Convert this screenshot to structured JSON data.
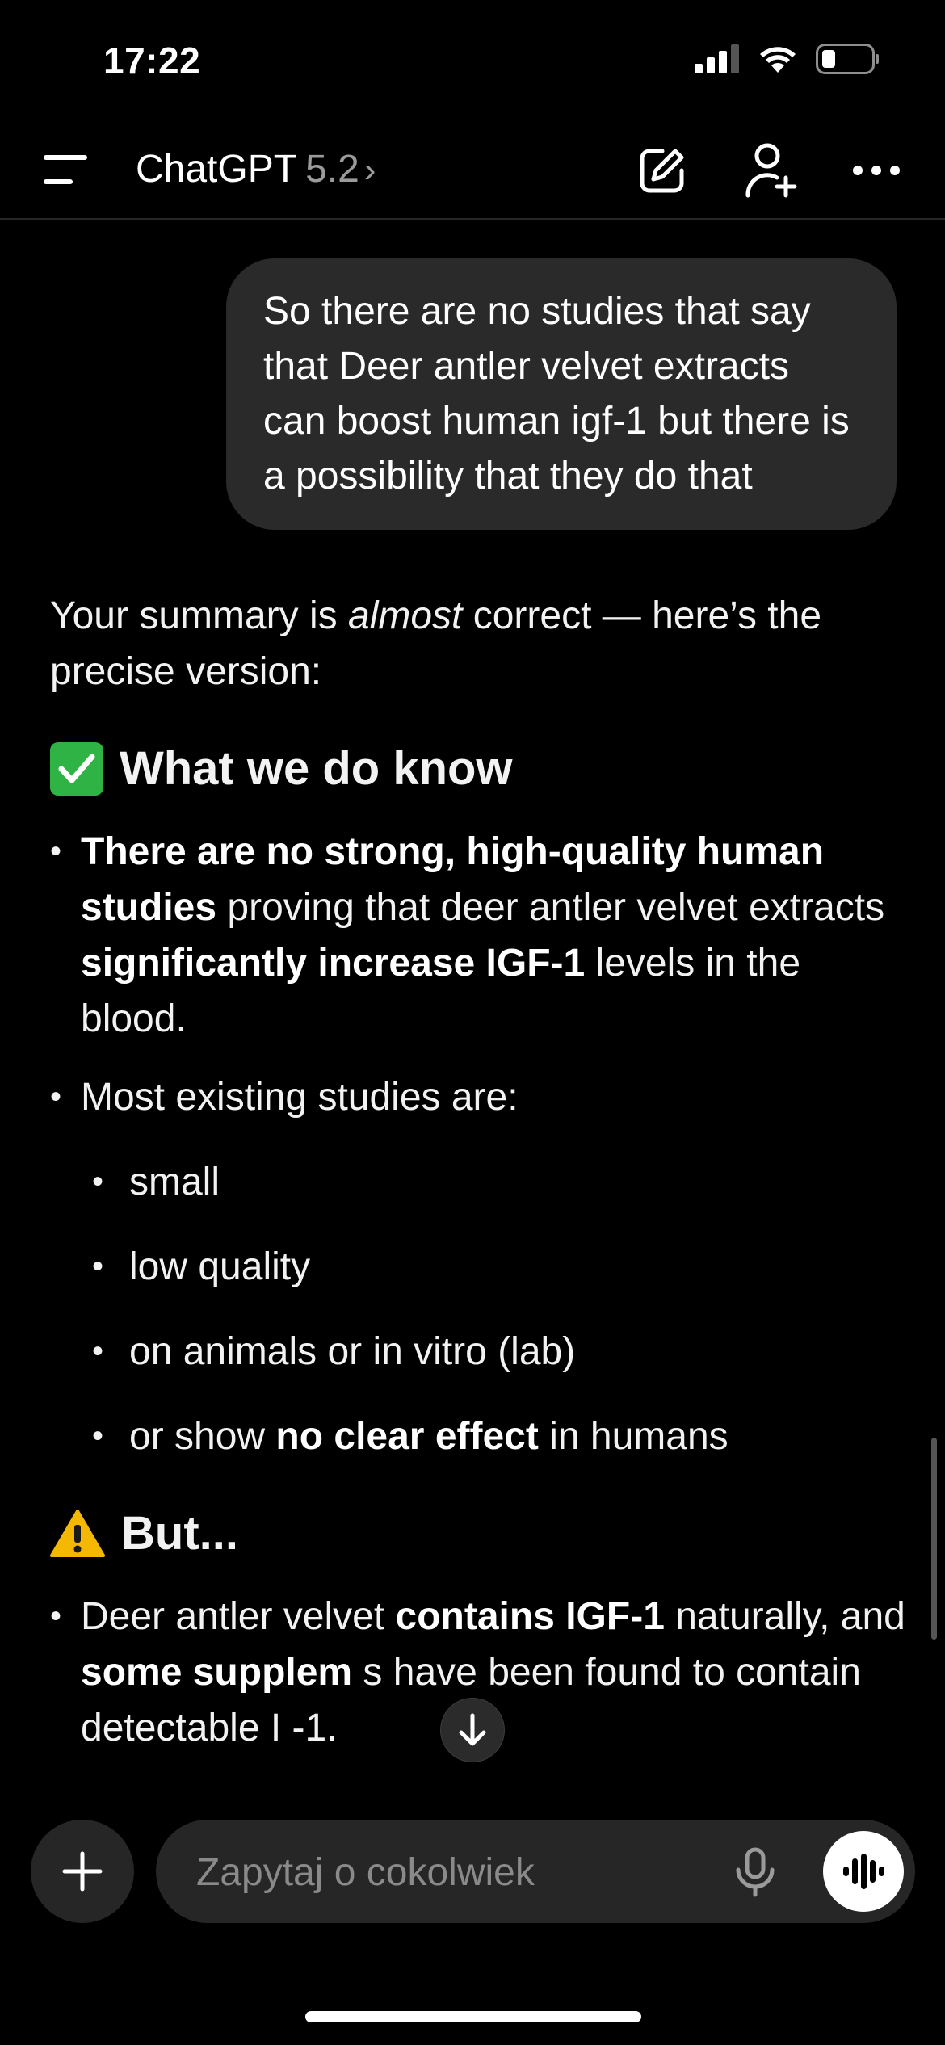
{
  "status": {
    "time": "17:22"
  },
  "header": {
    "title": "ChatGPT",
    "version": "5.2",
    "chevron": "›"
  },
  "user_message": "So there are no studies that say that Deer antler velvet extracts can boost human igf-1 but there is a possibility that they do that",
  "assistant": {
    "intro_pre": "Your summary is ",
    "intro_em": "almost",
    "intro_post": " correct — here’s the precise version:",
    "section1_title": "What we do know",
    "bullet1": {
      "b1": "There are no strong, high-quality human studies",
      "t1": " proving that deer antler velvet extracts ",
      "b2": "significantly increase IGF-1",
      "t2": " levels in the blood."
    },
    "bullet2": "Most existing studies are:",
    "sub_bullets": [
      "small",
      "low quality",
      "on animals or in vitro (lab)"
    ],
    "sub_bullet4": {
      "t1": "or show ",
      "b1": "no clear effect",
      "t2": " in humans"
    },
    "section2_title": "But...",
    "bullet3": {
      "t1": "Deer antler velvet ",
      "b1": "contains IGF-1",
      "t2": " naturally, and ",
      "b2": "some supplem",
      "t3": "   s have been found to contain detectable I",
      "t4": "   -1."
    }
  },
  "composer": {
    "placeholder": "Zapytaj o cokolwiek"
  },
  "icons": {
    "menu": "menu-icon",
    "new_chat": "edit-icon",
    "add_person": "add-person-icon",
    "more": "more-icon",
    "scroll_down": "arrow-down-icon",
    "plus": "plus-icon",
    "mic": "mic-icon",
    "voice": "voice-wave-icon"
  },
  "colors": {
    "bubble": "#2a2a2a",
    "composer": "#262626",
    "accent_check": "#2fb344",
    "warning": "#f5b800"
  }
}
